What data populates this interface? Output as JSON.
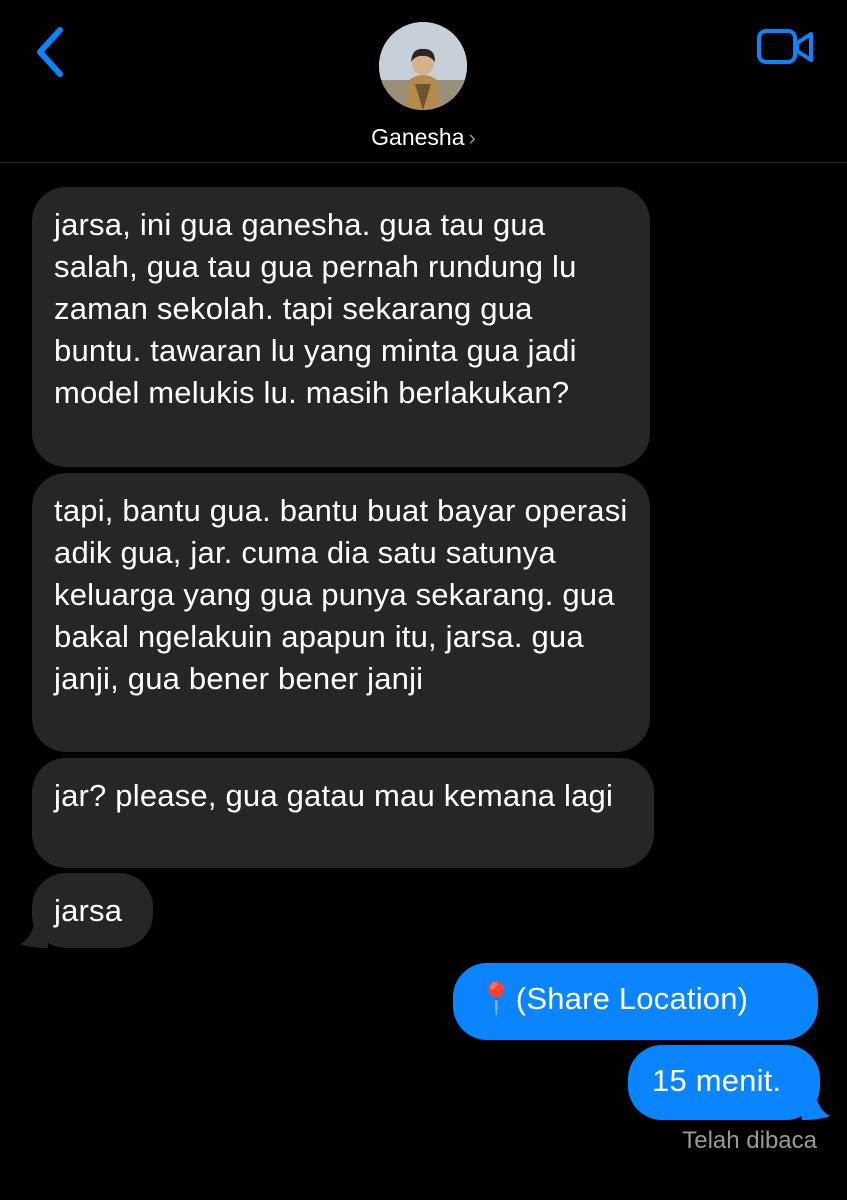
{
  "header": {
    "contact_name": "Ganesha",
    "back_icon": "chevron-left-icon",
    "video_icon": "video-camera-icon",
    "accent": "#0a84ff"
  },
  "messages": [
    {
      "direction": "incoming",
      "text": "jarsa, ini gua ganesha. gua tau gua salah, gua tau gua pernah rundung lu zaman sekolah. tapi sekarang gua buntu. tawaran lu yang minta gua jadi model melukis lu. masih berlakukan?"
    },
    {
      "direction": "incoming",
      "text": "tapi, bantu gua. bantu buat bayar operasi adik gua, jar. cuma dia satu satunya keluarga yang gua punya sekarang. gua bakal ngelakuin apapun itu, jarsa. gua janji, gua bener bener janji"
    },
    {
      "direction": "incoming",
      "text": "jar? please, gua gatau mau kemana lagi"
    },
    {
      "direction": "incoming",
      "text": "jarsa"
    },
    {
      "direction": "outgoing",
      "text": "📍(Share Location)"
    },
    {
      "direction": "outgoing",
      "text": "15 menit."
    }
  ],
  "read_status": "Telah dibaca"
}
